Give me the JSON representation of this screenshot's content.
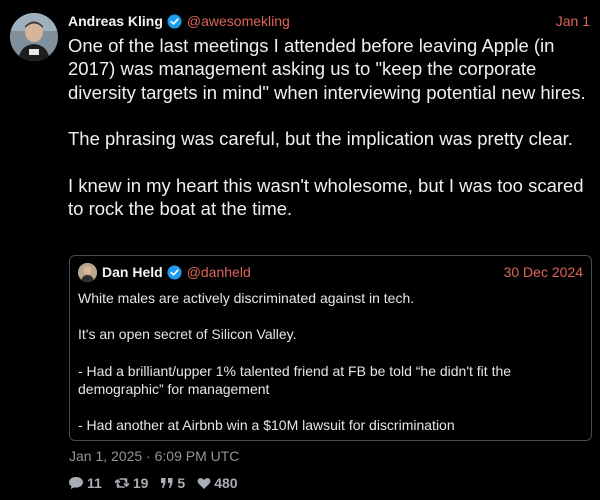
{
  "tweet": {
    "author": "Andreas Kling",
    "handle": "@awesomekling",
    "date": "Jan 1",
    "text": "One of the last meetings I attended before leaving Apple (in 2017) was management asking us to \"keep the corporate diversity targets in mind\" when interviewing potential new hires.\n\nThe phrasing was careful, but the implication was pretty clear.\n\nI knew in my heart this wasn't wholesome, but I was too scared to rock the boat at the time.",
    "timestamp": "Jan 1, 2025 · 6:09 PM UTC"
  },
  "quote": {
    "author": "Dan Held",
    "handle": "@danheld",
    "date": "30 Dec 2024",
    "text": "White males are actively discriminated against in tech.\n\nIt's an open secret of Silicon Valley.\n\n- Had a brilliant/upper 1% talented friend at FB be told “he didn't fit the demographic” for management\n\n- Had another at Airbnb win a $10M lawsuit for discrimination"
  },
  "stats": {
    "replies": "11",
    "retweets": "19",
    "quotes": "5",
    "likes": "480"
  },
  "colors": {
    "background": "#000000",
    "accent": "#e0645a",
    "verified": "#1d9bf0",
    "muted": "#8e959c"
  },
  "icons": [
    "verified-badge-icon",
    "reply-icon",
    "retweet-icon",
    "quote-icon",
    "heart-icon"
  ]
}
